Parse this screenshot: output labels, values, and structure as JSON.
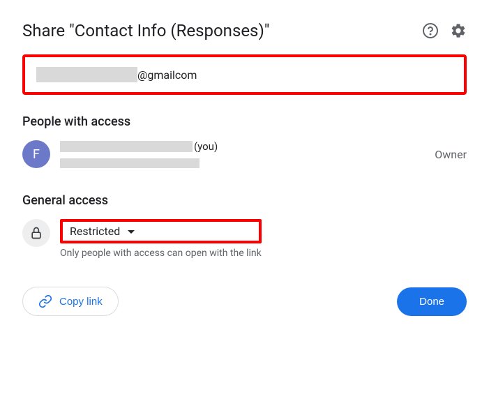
{
  "title": "Share \"Contact Info (Responses)\"",
  "input": {
    "suffix": "@gmailcom"
  },
  "people_section": {
    "heading": "People with access",
    "owner": {
      "avatar_letter": "F",
      "you_suffix": "(you)",
      "role": "Owner"
    }
  },
  "general_access": {
    "heading": "General access",
    "dropdown_label": "Restricted",
    "description": "Only people with access can open with the link"
  },
  "footer": {
    "copy_link": "Copy link",
    "done": "Done"
  }
}
